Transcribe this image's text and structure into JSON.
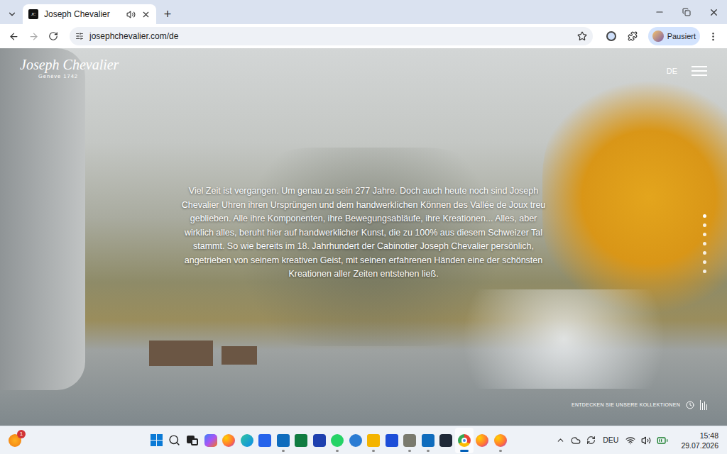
{
  "browser": {
    "tabs": [
      {
        "favicon": "JC",
        "title": "Joseph Chevalier",
        "selected": true
      }
    ],
    "new_tab": "+",
    "address": "josephchevalier.com/de",
    "profile": {
      "label": "Pausiert"
    }
  },
  "site": {
    "logo": {
      "name": "Joseph Chevalier",
      "tagline": "Genève 1742"
    },
    "language": "DE",
    "paragraph": "Viel Zeit ist vergangen. Um genau zu sein 277 Jahre. Doch auch heute noch sind Joseph Chevalier Uhren ihren Ursprüngen und dem handwerklichen Können des Vallée de Joux treu geblieben. Alle ihre Komponenten, ihre Bewegungsabläufe, ihre Kreationen... Alles, aber wirklich alles, beruht hier auf handwerklicher Kunst, die zu 100% aus diesem Schweizer Tal stammt. So wie bereits im 18. Jahrhundert der Cabinotier Joseph Chevalier persönlich, angetrieben von seinem kreativen Geist, mit seinen erfahrenen Händen eine der schönsten Kreationen aller Zeiten entstehen ließ.",
    "dots": [
      {
        "selected": true
      },
      {
        "selected": false
      },
      {
        "selected": false
      },
      {
        "selected": false
      },
      {
        "selected": false
      },
      {
        "selected": false
      },
      {
        "selected": false
      }
    ],
    "cta": "ENTDECKEN SIE UNSERE KOLLEKTIONEN"
  },
  "taskbar": {
    "notification_badge": "1",
    "apps": [
      {
        "running": false,
        "active": false
      },
      {
        "running": false,
        "active": false
      },
      {
        "running": false,
        "active": false
      },
      {
        "running": false,
        "active": false
      },
      {
        "running": false,
        "active": false
      },
      {
        "running": false,
        "active": false
      },
      {
        "running": false,
        "active": false
      },
      {
        "running": true,
        "active": false
      },
      {
        "running": false,
        "active": false
      },
      {
        "running": false,
        "active": false
      },
      {
        "running": true,
        "active": false
      },
      {
        "running": false,
        "active": false
      },
      {
        "running": true,
        "active": false
      },
      {
        "running": false,
        "active": false
      },
      {
        "running": true,
        "active": false
      },
      {
        "running": true,
        "active": false
      },
      {
        "running": false,
        "active": false
      },
      {
        "running": true,
        "active": true
      },
      {
        "running": false,
        "active": false
      },
      {
        "running": true,
        "active": false
      }
    ],
    "language": "DEU",
    "time": "15:48",
    "date": "29.07.2026"
  }
}
